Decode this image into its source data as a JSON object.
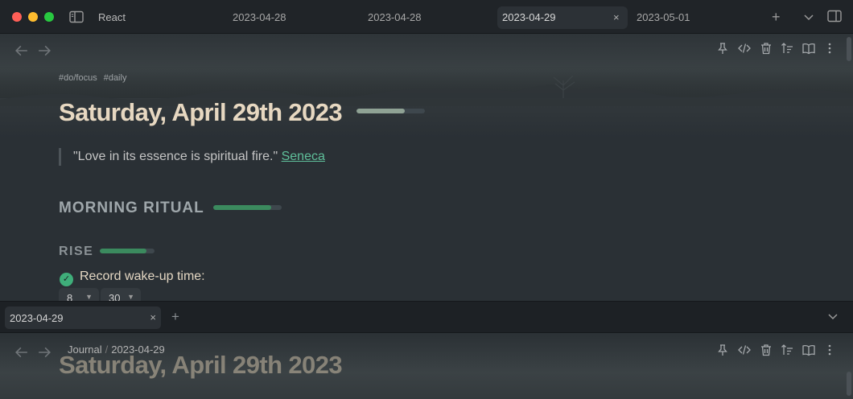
{
  "window": {
    "vault_name": "React",
    "tabs": [
      {
        "label": "2023-04-28"
      },
      {
        "label": "2023-04-28"
      },
      {
        "label": "2023-04-29",
        "active": true
      },
      {
        "label": "2023-05-01"
      }
    ],
    "tab_close": "×",
    "new_tab": "+"
  },
  "note": {
    "tags": [
      "#do/focus",
      "#daily"
    ],
    "title": "Saturday, April 29th 2023",
    "title_progress": 0.7,
    "quote_text": "\"Love in its essence is spiritual fire.\"",
    "quote_author": "Seneca",
    "section_morning": "MORNING RITUAL",
    "morning_progress": 0.85,
    "section_rise": "RISE",
    "rise_progress": 0.85,
    "task_label": "Record wake-up time:",
    "task_done": true,
    "wake_hour": "8",
    "wake_minute": "30"
  },
  "bottom": {
    "tab_label": "2023-04-29",
    "tab_close": "×",
    "new_tab": "+",
    "breadcrumb_root": "Journal",
    "breadcrumb_sep": "/",
    "breadcrumb_leaf": "2023-04-29",
    "ghost_title": "Saturday, April 29th 2023"
  },
  "colors": {
    "progress_fill_title": "#8fa294",
    "progress_fill_green": "#3b8a5e",
    "progress_track": "#3e474d",
    "link": "#5fbf9a",
    "check": "#3fae7a"
  },
  "icons": [
    "sidebar-toggle-icon",
    "back-arrow-icon",
    "forward-arrow-icon",
    "pin-icon",
    "code-icon",
    "trash-icon",
    "sort-icon",
    "book-icon",
    "more-icon",
    "plus-icon",
    "chevron-down-icon",
    "right-sidebar-icon",
    "close-icon",
    "check-icon"
  ]
}
